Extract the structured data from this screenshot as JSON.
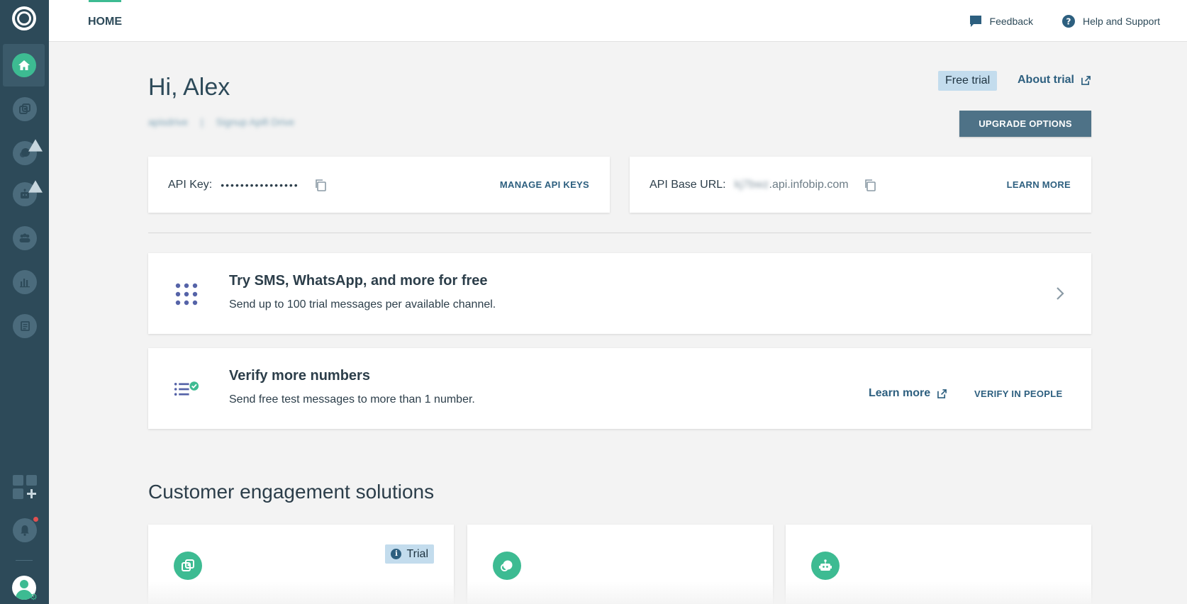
{
  "topbar": {
    "tab_home": "HOME",
    "feedback": "Feedback",
    "help": "Help and Support"
  },
  "header": {
    "greeting": "Hi, Alex",
    "account_name": "apisdrive",
    "separator": "|",
    "account_signup": "Signup Apifi Drive",
    "free_trial": "Free trial",
    "about_trial": "About trial",
    "upgrade": "UPGRADE OPTIONS"
  },
  "api_key_card": {
    "label": "API Key:",
    "value": "••••••••••••••••",
    "action": "MANAGE API KEYS"
  },
  "api_url_card": {
    "label": "API Base URL:",
    "value_blurred": "kj7bwz",
    "value_suffix": ".api.infobip.com",
    "action": "LEARN MORE"
  },
  "feature_try": {
    "title": "Try SMS, WhatsApp, and more for free",
    "desc": "Send up to 100 trial messages per available channel."
  },
  "feature_verify": {
    "title": "Verify more numbers",
    "desc": "Send free test messages to more than 1 number.",
    "learn_more": "Learn more",
    "verify_action": "VERIFY IN PEOPLE"
  },
  "solutions": {
    "title": "Customer engagement solutions",
    "cards": [
      {
        "icon": "moments-icon",
        "badge": "Trial"
      },
      {
        "icon": "conversations-icon"
      },
      {
        "icon": "answers-bot-icon"
      }
    ]
  },
  "sidebar": {
    "items": [
      {
        "icon": "home-icon",
        "active": true
      },
      {
        "icon": "moments-icon"
      },
      {
        "icon": "conversations-icon"
      },
      {
        "icon": "answers-bot-icon"
      },
      {
        "icon": "people-icon"
      },
      {
        "icon": "analyze-icon"
      },
      {
        "icon": "logs-icon"
      },
      {
        "icon": "apps-add-icon"
      },
      {
        "icon": "notifications-bell-icon"
      },
      {
        "icon": "user-avatar-icon"
      }
    ]
  },
  "colors": {
    "sidebar": "#2d4a59",
    "accent_green": "#3dbb92",
    "link_blue": "#2d5f7f",
    "badge_bg": "#c3dced",
    "button_bg": "#4e7287"
  }
}
